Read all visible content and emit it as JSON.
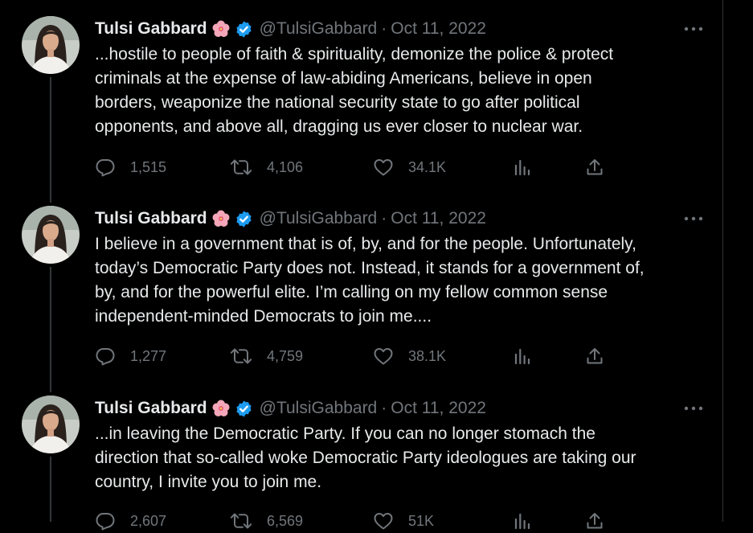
{
  "theme": {
    "background": "#000000",
    "text_primary": "#e7e9ea",
    "text_secondary": "#71767b",
    "verified_blue": "#1d9bf0",
    "divider": "#2f3336"
  },
  "icons": {
    "reply": "reply-icon",
    "retweet": "retweet-icon",
    "like": "heart-icon",
    "views": "analytics-icon",
    "share": "share-icon",
    "more": "more-icon",
    "verified": "verified-badge-icon",
    "emoji": "hibiscus-icon"
  },
  "tweets": [
    {
      "name": "Tulsi Gabbard",
      "handle": "@TulsiGabbard",
      "separator": "·",
      "date": "Oct 11, 2022",
      "text": "...hostile to people of faith & spirituality, demonize the police & protect\ncriminals at the expense of law-abiding Americans, believe in open\nborders, weaponize the national security state to go after political\nopponents, and above all, dragging us ever closer to nuclear war.",
      "replies": "1,515",
      "retweets": "4,106",
      "likes": "34.1K"
    },
    {
      "name": "Tulsi Gabbard",
      "handle": "@TulsiGabbard",
      "separator": "·",
      "date": "Oct 11, 2022",
      "text": "I believe in a government that is of, by, and for the people. Unfortunately,\ntoday’s Democratic Party does not. Instead, it stands for a government of,\nby, and for the powerful elite. I’m calling on my fellow common sense\nindependent-minded Democrats to join me....",
      "replies": "1,277",
      "retweets": "4,759",
      "likes": "38.1K"
    },
    {
      "name": "Tulsi Gabbard",
      "handle": "@TulsiGabbard",
      "separator": "·",
      "date": "Oct 11, 2022",
      "text": "...in leaving the Democratic Party. If you can no longer stomach the\ndirection that so-called woke Democratic Party ideologues are taking our\ncountry, I invite you to join me.",
      "replies": "2,607",
      "retweets": "6,569",
      "likes": "51K"
    }
  ]
}
